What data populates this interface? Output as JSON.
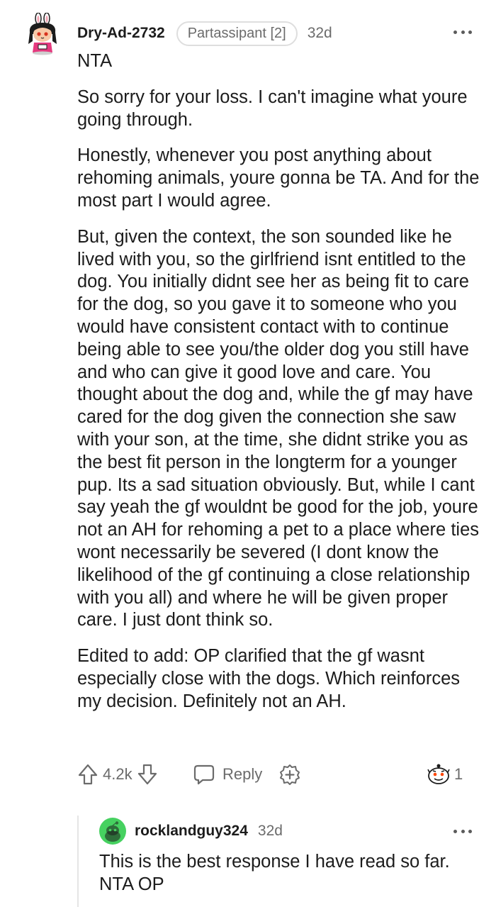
{
  "comment": {
    "username": "Dry-Ad-2732",
    "flair": "Partassipant [2]",
    "age": "32d",
    "paragraphs": [
      "NTA",
      "So sorry for your loss. I can't imagine what youre going through.",
      "Honestly, whenever you post anything about rehoming animals, youre gonna be TA. And for the most part I would agree.",
      "But, given the context, the son sounded like he lived with you, so the girlfriend isnt entitled to the dog. You initially didnt see her as being fit to care for the dog, so you gave it to someone who you would have consistent contact with to continue being able to see you/the older dog you still have and who can give it good love and care. You thought about the dog and, while the gf may have cared for the dog given the connection she saw with your son, at the time, she didnt strike you as the best fit person in the longterm for a younger pup. Its a sad situation obviously. But, while I cant say yeah the gf wouldnt be good for the job, youre not an AH for rehoming a pet to a place where ties wont necessarily be severed (I dont know the likelihood of the gf continuing a close relationship with you all) and where he will be given proper care. I just dont think so.",
      "Edited to add: OP clarified that the gf wasnt especially close with the dogs. Which reinforces my decision. Definitely not an AH."
    ],
    "score": "4.2k",
    "reply_label": "Reply",
    "award_count": "1"
  },
  "reply": {
    "username": "rocklandguy324",
    "age": "32d",
    "text": "This is the best response I have read so far. NTA OP"
  },
  "icons": {
    "upvote": "upvote-arrow-icon",
    "downvote": "downvote-arrow-icon",
    "reply": "speech-bubble-icon",
    "award": "plus-circle-icon",
    "awarded": "award-face-icon",
    "more": "ellipsis-icon"
  },
  "colors": {
    "text": "#1c1c1c",
    "meta": "#6b6b6b",
    "flair_border": "#dedede",
    "reply_avatar": "#46d160"
  }
}
